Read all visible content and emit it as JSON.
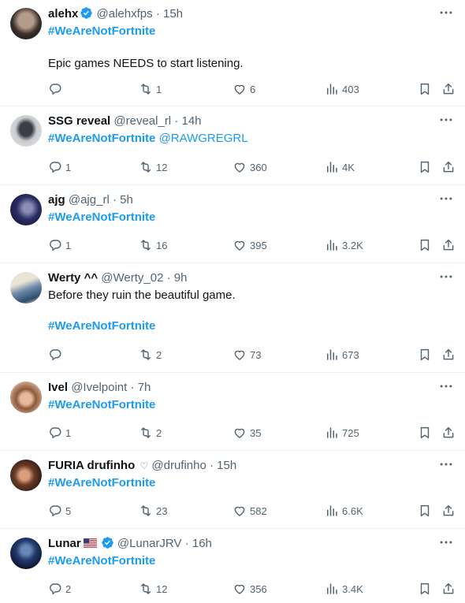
{
  "tweets": [
    {
      "name": "alehx",
      "handle": "@alehxfps",
      "time": "15h",
      "verified": true,
      "flag": false,
      "heart": false,
      "hashtag": "#WeAreNotFortnite",
      "mention": "",
      "text": "Epic games NEEDS to start listening.",
      "replies": "",
      "retweets": "1",
      "likes": "6",
      "views": "403"
    },
    {
      "name": "SSG reveal",
      "handle": "@reveal_rl",
      "time": "14h",
      "verified": false,
      "flag": false,
      "heart": false,
      "hashtag": "#WeAreNotFortnite",
      "mention": "@RAWGREGRL",
      "text": "",
      "replies": "1",
      "retweets": "12",
      "likes": "360",
      "views": "4K"
    },
    {
      "name": "ajg",
      "handle": "@ajg_rl",
      "time": "5h",
      "verified": false,
      "flag": false,
      "heart": false,
      "hashtag": "#WeAreNotFortnite",
      "mention": "",
      "text": "",
      "replies": "1",
      "retweets": "16",
      "likes": "395",
      "views": "3.2K"
    },
    {
      "name": "Werty ^^",
      "handle": "@Werty_02",
      "time": "9h",
      "verified": false,
      "flag": false,
      "heart": false,
      "hashtag": "#WeAreNotFortnite",
      "mention": "",
      "text": "Before they ruin the beautiful game.",
      "replies": "",
      "retweets": "2",
      "likes": "73",
      "views": "673"
    },
    {
      "name": "Ivel",
      "handle": "@Ivelpoint",
      "time": "7h",
      "verified": false,
      "flag": false,
      "heart": false,
      "hashtag": "#WeAreNotFortnite",
      "mention": "",
      "text": "",
      "replies": "1",
      "retweets": "2",
      "likes": "35",
      "views": "725"
    },
    {
      "name": "FURIA drufinho",
      "handle": "@drufinho",
      "time": "15h",
      "verified": false,
      "flag": false,
      "heart": true,
      "hashtag": "#WeAreNotFortnite",
      "mention": "",
      "text": "",
      "replies": "5",
      "retweets": "23",
      "likes": "582",
      "views": "6.6K"
    },
    {
      "name": "Lunar",
      "handle": "@LunarJRV",
      "time": "16h",
      "verified": true,
      "flag": true,
      "heart": false,
      "hashtag": "#WeAreNotFortnite",
      "mention": "",
      "text": "",
      "replies": "2",
      "retweets": "12",
      "likes": "356",
      "views": "3.4K"
    }
  ],
  "symbols": {
    "dot": "·",
    "heart": "♡"
  },
  "colors": {
    "link": "#1d9bf0",
    "muted": "#536471",
    "text": "#0f1419",
    "divider": "#eff3f4",
    "verified": "#1d9bf0"
  }
}
